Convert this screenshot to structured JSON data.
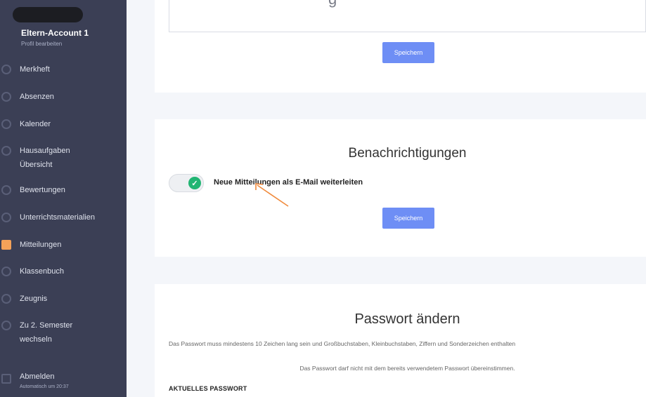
{
  "sidebar": {
    "account_name": "Eltern-Account 1",
    "profile_link": "Profil bearbeiten",
    "items": [
      {
        "label": "Merkheft"
      },
      {
        "label": "Absenzen"
      },
      {
        "label": "Kalender"
      },
      {
        "label": "Hausaufgaben",
        "label2": "Übersicht"
      },
      {
        "label": "Bewertungen"
      },
      {
        "label": "Unterrichtsmaterialien"
      },
      {
        "label": "Mitteilungen",
        "active": true
      },
      {
        "label": "Klassenbuch"
      },
      {
        "label": "Zeugnis"
      },
      {
        "label": "Zu 2. Semester",
        "label2": "wechseln"
      }
    ],
    "logout_label": "Abmelden",
    "logout_note": "Automatisch um 20:37"
  },
  "card1": {
    "save_label": "Speichern"
  },
  "notifications": {
    "title": "Benachrichtigungen",
    "toggle_label": "Neue Mitteilungen als E-Mail weiterleiten",
    "toggle_on": true,
    "save_label": "Speichern"
  },
  "password": {
    "title": "Passwort ändern",
    "note1": "Das Passwort muss mindestens 10 Zeichen lang sein und Großbuchstaben, Kleinbuchstaben, Ziffern und Sonderzeichen enthalten",
    "note2": "Das Passwort darf nicht mit dem bereits verwendetem Passwort übereinstimmen.",
    "current_label": "AKTUELLES PASSWORT"
  },
  "colors": {
    "sidebar_bg": "#3b3f55",
    "button": "#6e8ef5",
    "toggle_on": "#22b573",
    "active_marker": "#f4a259",
    "annotation_arrow": "#f08a3c"
  }
}
